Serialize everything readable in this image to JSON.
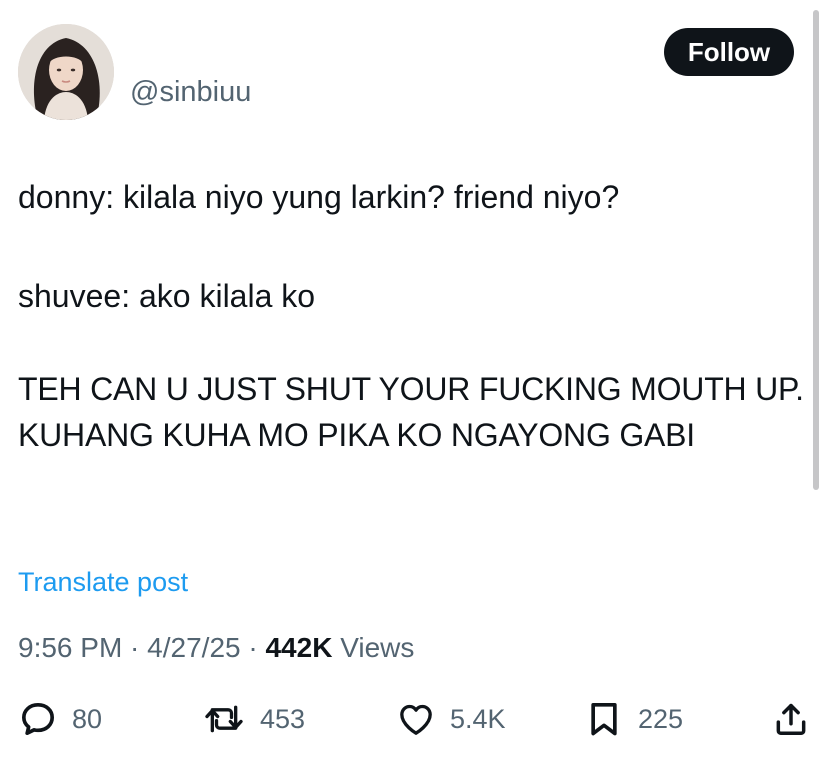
{
  "header": {
    "handle": "@sinbiuu",
    "follow_label": "Follow",
    "avatar_icon": "profile-photo"
  },
  "tweet": {
    "lines": [
      "donny: kilala niyo yung larkin? friend niyo?",
      "shuvee: ako kilala ko",
      "TEH CAN U JUST SHUT YOUR FUCKING MOUTH UP. KUHANG KUHA MO PIKA KO NGAYONG GABI"
    ],
    "translate_label": "Translate post"
  },
  "meta": {
    "time": "9:56 PM",
    "separator": " · ",
    "date": "4/27/25",
    "views_count": "442K",
    "views_label": "Views"
  },
  "actions": {
    "reply_count": "80",
    "retweet_count": "453",
    "like_count": "5.4K",
    "bookmark_count": "225",
    "icons": [
      "reply-icon",
      "retweet-icon",
      "like-icon",
      "bookmark-icon",
      "share-icon"
    ]
  },
  "colors": {
    "text": "#0f1419",
    "secondary": "#536471",
    "link": "#1d9bf0",
    "button_bg": "#0f1419",
    "button_text": "#ffffff"
  }
}
